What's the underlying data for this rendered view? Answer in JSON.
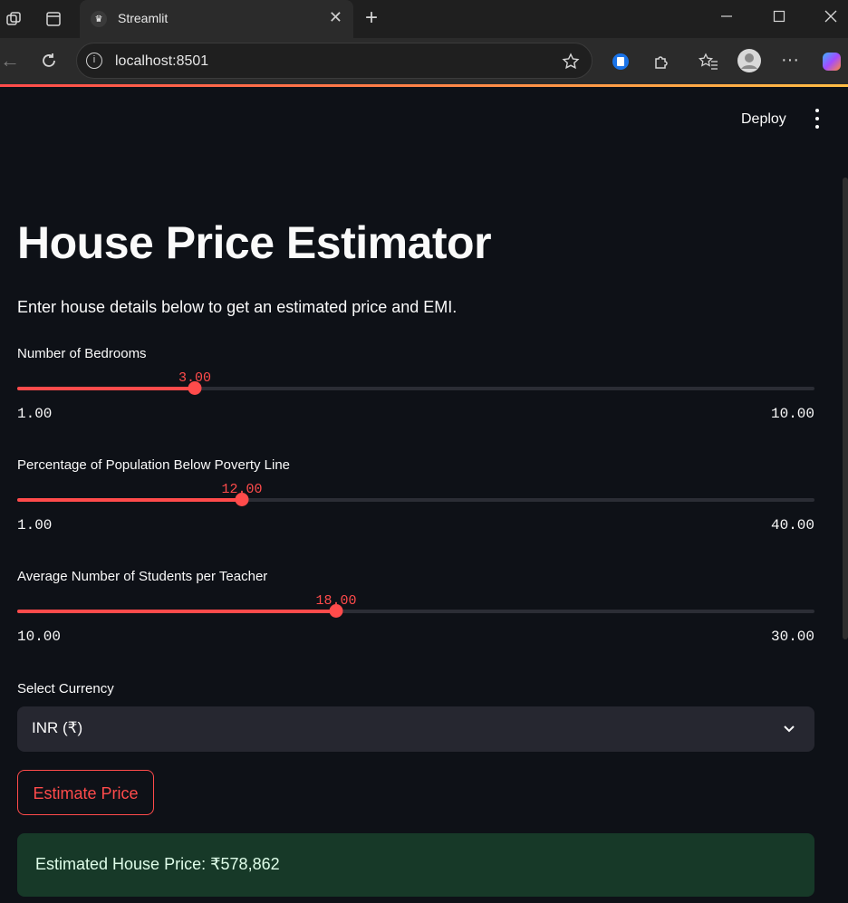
{
  "browser": {
    "tab_title": "Streamlit",
    "url": "localhost:8501"
  },
  "header": {
    "deploy_label": "Deploy"
  },
  "page": {
    "title": "House Price Estimator",
    "subtitle": "Enter house details below to get an estimated price and EMI."
  },
  "sliders": [
    {
      "label": "Number of Bedrooms",
      "value": "3.00",
      "min": "1.00",
      "max": "10.00",
      "fraction": 0.2222
    },
    {
      "label": "Percentage of Population Below Poverty Line",
      "value": "12.00",
      "min": "1.00",
      "max": "40.00",
      "fraction": 0.2821
    },
    {
      "label": "Average Number of Students per Teacher",
      "value": "18.00",
      "min": "10.00",
      "max": "30.00",
      "fraction": 0.4
    }
  ],
  "currency": {
    "label": "Select Currency",
    "selected": "INR (₹)"
  },
  "estimate_button": {
    "label": "Estimate Price"
  },
  "result": {
    "text": "Estimated House Price: ₹578,862"
  },
  "colors": {
    "accent": "#ff4b4b",
    "background": "#0e1117",
    "success_bg": "#173928"
  }
}
